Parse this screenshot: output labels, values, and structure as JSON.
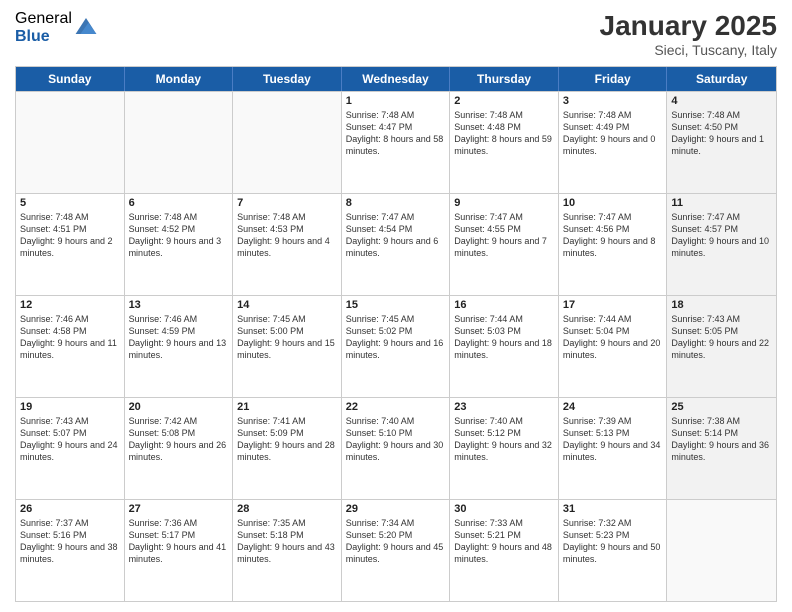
{
  "logo": {
    "general": "General",
    "blue": "Blue"
  },
  "header": {
    "title": "January 2025",
    "subtitle": "Sieci, Tuscany, Italy"
  },
  "weekdays": [
    "Sunday",
    "Monday",
    "Tuesday",
    "Wednesday",
    "Thursday",
    "Friday",
    "Saturday"
  ],
  "rows": [
    [
      {
        "day": "",
        "text": "",
        "shaded": false,
        "empty": true
      },
      {
        "day": "",
        "text": "",
        "shaded": false,
        "empty": true
      },
      {
        "day": "",
        "text": "",
        "shaded": false,
        "empty": true
      },
      {
        "day": "1",
        "text": "Sunrise: 7:48 AM\nSunset: 4:47 PM\nDaylight: 8 hours and 58 minutes.",
        "shaded": false,
        "empty": false
      },
      {
        "day": "2",
        "text": "Sunrise: 7:48 AM\nSunset: 4:48 PM\nDaylight: 8 hours and 59 minutes.",
        "shaded": false,
        "empty": false
      },
      {
        "day": "3",
        "text": "Sunrise: 7:48 AM\nSunset: 4:49 PM\nDaylight: 9 hours and 0 minutes.",
        "shaded": false,
        "empty": false
      },
      {
        "day": "4",
        "text": "Sunrise: 7:48 AM\nSunset: 4:50 PM\nDaylight: 9 hours and 1 minute.",
        "shaded": true,
        "empty": false
      }
    ],
    [
      {
        "day": "5",
        "text": "Sunrise: 7:48 AM\nSunset: 4:51 PM\nDaylight: 9 hours and 2 minutes.",
        "shaded": false,
        "empty": false
      },
      {
        "day": "6",
        "text": "Sunrise: 7:48 AM\nSunset: 4:52 PM\nDaylight: 9 hours and 3 minutes.",
        "shaded": false,
        "empty": false
      },
      {
        "day": "7",
        "text": "Sunrise: 7:48 AM\nSunset: 4:53 PM\nDaylight: 9 hours and 4 minutes.",
        "shaded": false,
        "empty": false
      },
      {
        "day": "8",
        "text": "Sunrise: 7:47 AM\nSunset: 4:54 PM\nDaylight: 9 hours and 6 minutes.",
        "shaded": false,
        "empty": false
      },
      {
        "day": "9",
        "text": "Sunrise: 7:47 AM\nSunset: 4:55 PM\nDaylight: 9 hours and 7 minutes.",
        "shaded": false,
        "empty": false
      },
      {
        "day": "10",
        "text": "Sunrise: 7:47 AM\nSunset: 4:56 PM\nDaylight: 9 hours and 8 minutes.",
        "shaded": false,
        "empty": false
      },
      {
        "day": "11",
        "text": "Sunrise: 7:47 AM\nSunset: 4:57 PM\nDaylight: 9 hours and 10 minutes.",
        "shaded": true,
        "empty": false
      }
    ],
    [
      {
        "day": "12",
        "text": "Sunrise: 7:46 AM\nSunset: 4:58 PM\nDaylight: 9 hours and 11 minutes.",
        "shaded": false,
        "empty": false
      },
      {
        "day": "13",
        "text": "Sunrise: 7:46 AM\nSunset: 4:59 PM\nDaylight: 9 hours and 13 minutes.",
        "shaded": false,
        "empty": false
      },
      {
        "day": "14",
        "text": "Sunrise: 7:45 AM\nSunset: 5:00 PM\nDaylight: 9 hours and 15 minutes.",
        "shaded": false,
        "empty": false
      },
      {
        "day": "15",
        "text": "Sunrise: 7:45 AM\nSunset: 5:02 PM\nDaylight: 9 hours and 16 minutes.",
        "shaded": false,
        "empty": false
      },
      {
        "day": "16",
        "text": "Sunrise: 7:44 AM\nSunset: 5:03 PM\nDaylight: 9 hours and 18 minutes.",
        "shaded": false,
        "empty": false
      },
      {
        "day": "17",
        "text": "Sunrise: 7:44 AM\nSunset: 5:04 PM\nDaylight: 9 hours and 20 minutes.",
        "shaded": false,
        "empty": false
      },
      {
        "day": "18",
        "text": "Sunrise: 7:43 AM\nSunset: 5:05 PM\nDaylight: 9 hours and 22 minutes.",
        "shaded": true,
        "empty": false
      }
    ],
    [
      {
        "day": "19",
        "text": "Sunrise: 7:43 AM\nSunset: 5:07 PM\nDaylight: 9 hours and 24 minutes.",
        "shaded": false,
        "empty": false
      },
      {
        "day": "20",
        "text": "Sunrise: 7:42 AM\nSunset: 5:08 PM\nDaylight: 9 hours and 26 minutes.",
        "shaded": false,
        "empty": false
      },
      {
        "day": "21",
        "text": "Sunrise: 7:41 AM\nSunset: 5:09 PM\nDaylight: 9 hours and 28 minutes.",
        "shaded": false,
        "empty": false
      },
      {
        "day": "22",
        "text": "Sunrise: 7:40 AM\nSunset: 5:10 PM\nDaylight: 9 hours and 30 minutes.",
        "shaded": false,
        "empty": false
      },
      {
        "day": "23",
        "text": "Sunrise: 7:40 AM\nSunset: 5:12 PM\nDaylight: 9 hours and 32 minutes.",
        "shaded": false,
        "empty": false
      },
      {
        "day": "24",
        "text": "Sunrise: 7:39 AM\nSunset: 5:13 PM\nDaylight: 9 hours and 34 minutes.",
        "shaded": false,
        "empty": false
      },
      {
        "day": "25",
        "text": "Sunrise: 7:38 AM\nSunset: 5:14 PM\nDaylight: 9 hours and 36 minutes.",
        "shaded": true,
        "empty": false
      }
    ],
    [
      {
        "day": "26",
        "text": "Sunrise: 7:37 AM\nSunset: 5:16 PM\nDaylight: 9 hours and 38 minutes.",
        "shaded": false,
        "empty": false
      },
      {
        "day": "27",
        "text": "Sunrise: 7:36 AM\nSunset: 5:17 PM\nDaylight: 9 hours and 41 minutes.",
        "shaded": false,
        "empty": false
      },
      {
        "day": "28",
        "text": "Sunrise: 7:35 AM\nSunset: 5:18 PM\nDaylight: 9 hours and 43 minutes.",
        "shaded": false,
        "empty": false
      },
      {
        "day": "29",
        "text": "Sunrise: 7:34 AM\nSunset: 5:20 PM\nDaylight: 9 hours and 45 minutes.",
        "shaded": false,
        "empty": false
      },
      {
        "day": "30",
        "text": "Sunrise: 7:33 AM\nSunset: 5:21 PM\nDaylight: 9 hours and 48 minutes.",
        "shaded": false,
        "empty": false
      },
      {
        "day": "31",
        "text": "Sunrise: 7:32 AM\nSunset: 5:23 PM\nDaylight: 9 hours and 50 minutes.",
        "shaded": false,
        "empty": false
      },
      {
        "day": "",
        "text": "",
        "shaded": true,
        "empty": true
      }
    ]
  ]
}
